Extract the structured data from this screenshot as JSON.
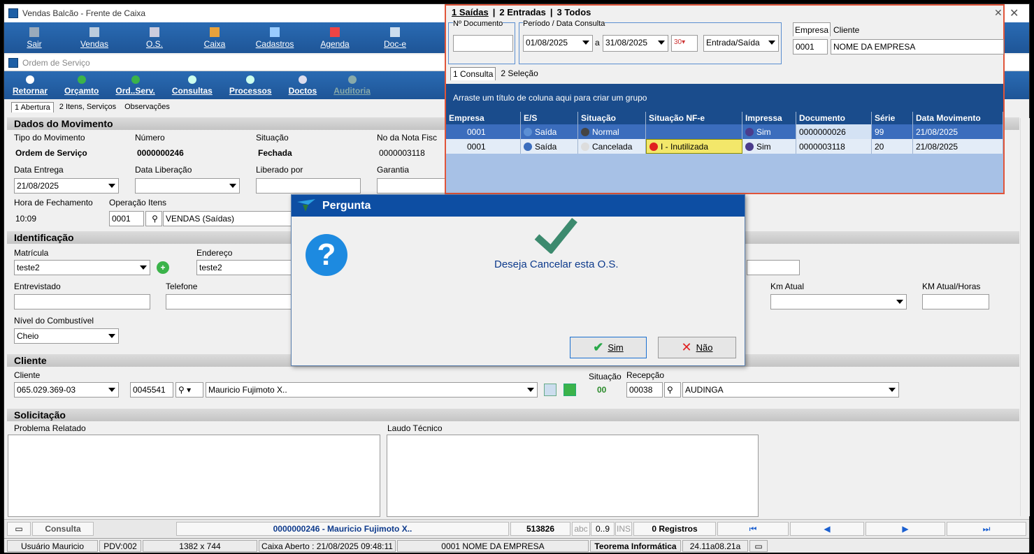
{
  "window": {
    "title": "Vendas Balcão - Frente de Caixa"
  },
  "toolbar": {
    "buttons": [
      "Sair",
      "Vendas",
      "O.S.",
      "Caixa",
      "Cadastros",
      "Agenda",
      "Doc-e"
    ]
  },
  "subwindow": {
    "title": "Ordem de Serviço"
  },
  "toolbar2": {
    "buttons": [
      "Retornar",
      "Orçamto",
      "Ord..Serv.",
      "Consultas",
      "Processos",
      "Doctos",
      "Auditoria"
    ]
  },
  "tabs": [
    "1 Abertura",
    "2 Itens, Serviços",
    "Observações"
  ],
  "dados": {
    "header": "Dados do Movimento",
    "tipo_label": "Tipo do Movimento",
    "tipo_value": "Ordem de Serviço",
    "numero_label": "Número",
    "numero_value": "0000000246",
    "situacao_label": "Situação",
    "situacao_value": "Fechada",
    "nota_label": "No da Nota Fisc",
    "nota_value": "0000003118",
    "data_entrega_label": "Data Entrega",
    "data_entrega_value": "21/08/2025",
    "data_liberacao_label": "Data Liberação",
    "liberado_label": "Liberado por",
    "garantia_label": "Garantia",
    "hora_label": "Hora de Fechamento",
    "hora_value": "10:09",
    "operacao_label": "Operação Itens",
    "operacao_code": "0001",
    "operacao_desc": "VENDAS (Saídas)"
  },
  "identificacao": {
    "header": "Identificação",
    "matricula_label": "Matrícula",
    "matricula_value": "teste2",
    "endereco_label": "Endereço",
    "endereco_value": "teste2",
    "entrevistado_label": "Entrevistado",
    "telefone_label": "Telefone",
    "km_label": "Km Atual",
    "km_horas_label": "KM Atual/Horas",
    "combustivel_label": "Nível do Combustível",
    "combustivel_value": "Cheio"
  },
  "cliente": {
    "header": "Cliente",
    "label": "Cliente",
    "cpf": "065.029.369-03",
    "codigo": "0045541",
    "nome": "Mauricio Fujimoto X..",
    "situacao_label": "Situação",
    "situacao_value": "00",
    "recepcao_label": "Recepção",
    "recepcao_code": "00038",
    "recepcao_nome": "AUDINGA"
  },
  "solicitacao": {
    "header": "Solicitação",
    "problema_label": "Problema Relatado",
    "laudo_label": "Laudo Técnico"
  },
  "statusbar": {
    "consulta": "Consulta",
    "info": "0000000246 - Mauricio Fujimoto X..",
    "num": "513826",
    "abc": "abc",
    "digits": "0..9",
    "ins": "INS",
    "registros": "0 Registros"
  },
  "bottombar": {
    "usuario": "Usuário Mauricio",
    "pdv": "PDV:002",
    "res": "1382 x 744",
    "caixa": "Caixa Aberto : 21/08/2025 09:48:11",
    "empresa": "0001 NOME DA EMPRESA",
    "teorema": "Teorema Informática",
    "versao": "24.11a08.21a"
  },
  "panel": {
    "tabs": [
      "1 Saídas",
      "2 Entradas",
      "3 Todos"
    ],
    "ndoc_label": "Nº Documento",
    "periodo_label": "Período / Data Consulta",
    "date_from": "01/08/2025",
    "date_sep": "a",
    "date_to": "31/08/2025",
    "tipo": "Entrada/Saída",
    "empresa_tab": "Empresa",
    "cliente_tab": "Cliente",
    "empresa_code": "0001",
    "empresa_nome": "NOME DA EMPRESA",
    "subtabs": [
      "1 Consulta",
      "2 Seleção"
    ],
    "group_hint": "Arraste um título de coluna aqui para criar um grupo",
    "columns": [
      "Empresa",
      "E/S",
      "Situação",
      "Situação NF-e",
      "Impressa",
      "Documento",
      "Série",
      "Data Movimento"
    ],
    "rows": [
      {
        "empresa": "0001",
        "es": "Saída",
        "situacao": "Normal",
        "nfe": "",
        "impressa": "Sim",
        "documento": "0000000026",
        "serie": "99",
        "data": "21/08/2025"
      },
      {
        "empresa": "0001",
        "es": "Saída",
        "situacao": "Cancelada",
        "nfe": "I - Inutilizada",
        "impressa": "Sim",
        "documento": "0000003118",
        "serie": "20",
        "data": "21/08/2025"
      }
    ]
  },
  "dialog": {
    "title": "Pergunta",
    "message": "Deseja Cancelar esta O.S.",
    "yes": "Sim",
    "no": "Não"
  }
}
